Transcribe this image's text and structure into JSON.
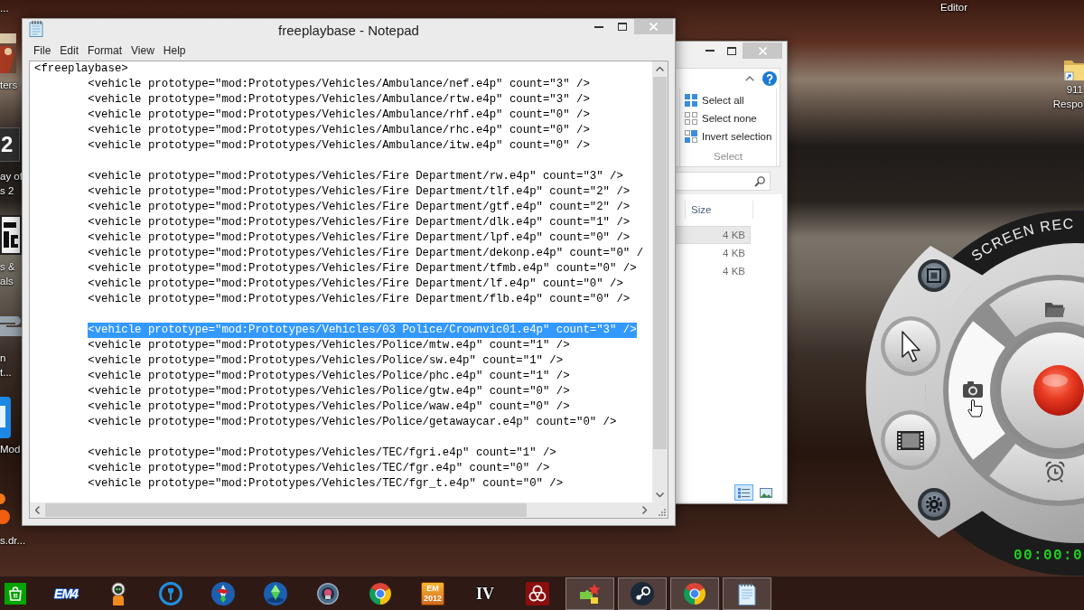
{
  "desktop": {
    "left_icons": [
      {
        "kind": "none",
        "label_lines": [
          "..."
        ]
      },
      {
        "kind": "game-art",
        "label_lines": [
          "ters"
        ]
      },
      {
        "kind": "dark-tile",
        "logo_text": "2",
        "label_lines": [
          "ay of",
          "s 2"
        ]
      },
      {
        "kind": "white-tile",
        "label_lines": [
          "s &",
          "als"
        ]
      },
      {
        "kind": "gray-logo",
        "label_lines": [
          "n",
          "t..."
        ]
      },
      {
        "kind": "blue-tile",
        "label_lines": [
          "Mod"
        ]
      },
      {
        "kind": "orange-dots",
        "label_lines": [
          "s.dr..."
        ]
      }
    ],
    "right_icons": [
      {
        "kind": "none",
        "label_lines": [
          "Editor"
        ]
      },
      {
        "kind": "folder-shortcut",
        "label_lines": [
          "911",
          "Respo"
        ]
      }
    ]
  },
  "notepad": {
    "title": "freeplaybase - Notepad",
    "menu": [
      "File",
      "Edit",
      "Format",
      "View",
      "Help"
    ],
    "root_line": {
      "text": "<freeplaybase>",
      "selected": false
    },
    "groups": [
      {
        "lines": [
          {
            "text": "<vehicle prototype=\"mod:Prototypes/Vehicles/Ambulance/nef.e4p\" count=\"3\" />",
            "selected": false
          },
          {
            "text": "<vehicle prototype=\"mod:Prototypes/Vehicles/Ambulance/rtw.e4p\" count=\"3\" />",
            "selected": false
          },
          {
            "text": "<vehicle prototype=\"mod:Prototypes/Vehicles/Ambulance/rhf.e4p\" count=\"0\" />",
            "selected": false
          },
          {
            "text": "<vehicle prototype=\"mod:Prototypes/Vehicles/Ambulance/rhc.e4p\" count=\"0\" />",
            "selected": false
          },
          {
            "text": "<vehicle prototype=\"mod:Prototypes/Vehicles/Ambulance/itw.e4p\" count=\"0\" />",
            "selected": false
          }
        ]
      },
      {
        "lines": [
          {
            "text": "<vehicle prototype=\"mod:Prototypes/Vehicles/Fire Department/rw.e4p\" count=\"3\" />",
            "selected": false
          },
          {
            "text": "<vehicle prototype=\"mod:Prototypes/Vehicles/Fire Department/tlf.e4p\" count=\"2\" />",
            "selected": false
          },
          {
            "text": "<vehicle prototype=\"mod:Prototypes/Vehicles/Fire Department/gtf.e4p\" count=\"2\" />",
            "selected": false
          },
          {
            "text": "<vehicle prototype=\"mod:Prototypes/Vehicles/Fire Department/dlk.e4p\" count=\"1\" />",
            "selected": false
          },
          {
            "text": "<vehicle prototype=\"mod:Prototypes/Vehicles/Fire Department/lpf.e4p\" count=\"0\" />",
            "selected": false
          },
          {
            "text": "<vehicle prototype=\"mod:Prototypes/Vehicles/Fire Department/dekonp.e4p\" count=\"0\" /",
            "selected": false
          },
          {
            "text": "<vehicle prototype=\"mod:Prototypes/Vehicles/Fire Department/tfmb.e4p\" count=\"0\" />",
            "selected": false
          },
          {
            "text": "<vehicle prototype=\"mod:Prototypes/Vehicles/Fire Department/lf.e4p\" count=\"0\" />",
            "selected": false
          },
          {
            "text": "<vehicle prototype=\"mod:Prototypes/Vehicles/Fire Department/flb.e4p\" count=\"0\" />",
            "selected": false
          }
        ]
      },
      {
        "lines": [
          {
            "text": "<vehicle prototype=\"mod:Prototypes/Vehicles/03 Police/Crownvic01.e4p\" count=\"3\" />",
            "selected": true
          },
          {
            "text": "<vehicle prototype=\"mod:Prototypes/Vehicles/Police/mtw.e4p\" count=\"1\" />",
            "selected": false
          },
          {
            "text": "<vehicle prototype=\"mod:Prototypes/Vehicles/Police/sw.e4p\" count=\"1\" />",
            "selected": false
          },
          {
            "text": "<vehicle prototype=\"mod:Prototypes/Vehicles/Police/phc.e4p\" count=\"1\" />",
            "selected": false
          },
          {
            "text": "<vehicle prototype=\"mod:Prototypes/Vehicles/Police/gtw.e4p\" count=\"0\" />",
            "selected": false
          },
          {
            "text": "<vehicle prototype=\"mod:Prototypes/Vehicles/Police/waw.e4p\" count=\"0\" />",
            "selected": false
          },
          {
            "text": "<vehicle prototype=\"mod:Prototypes/Vehicles/Police/getawaycar.e4p\" count=\"0\" />",
            "selected": false
          }
        ]
      },
      {
        "lines": [
          {
            "text": "<vehicle prototype=\"mod:Prototypes/Vehicles/TEC/fgri.e4p\" count=\"1\" />",
            "selected": false
          },
          {
            "text": "<vehicle prototype=\"mod:Prototypes/Vehicles/TEC/fgr.e4p\" count=\"0\" />",
            "selected": false
          },
          {
            "text": "<vehicle prototype=\"mod:Prototypes/Vehicles/TEC/fgr_t.e4p\" count=\"0\" />",
            "selected": false
          }
        ]
      }
    ]
  },
  "explorer": {
    "commands": [
      {
        "kind": "select-all",
        "label": "Select all"
      },
      {
        "kind": "select-none",
        "label": "Select none"
      },
      {
        "kind": "invert",
        "label": "Invert selection"
      }
    ],
    "group_label": "Select",
    "columns": [
      "Size"
    ],
    "rows": [
      {
        "size": "4 KB",
        "selected": true
      },
      {
        "size": "4 KB",
        "selected": false
      },
      {
        "size": "4 KB",
        "selected": false
      }
    ],
    "views": [
      {
        "kind": "details",
        "selected": true
      },
      {
        "kind": "large-icons",
        "selected": false
      }
    ]
  },
  "recorder": {
    "title": "SCREEN REC",
    "segments": [
      {
        "kind": "folder",
        "hovered": false
      },
      {
        "kind": "camera",
        "hovered": true
      },
      {
        "kind": "alarm",
        "hovered": false
      }
    ],
    "timer": "00:00:0"
  },
  "taskbar": {
    "items": [
      {
        "kind": "store",
        "running": false
      },
      {
        "kind": "logo-text",
        "logo_text": "EM4",
        "running": false
      },
      {
        "kind": "astronaut",
        "running": false
      },
      {
        "kind": "ring-figure",
        "running": false
      },
      {
        "kind": "bird-plumbob",
        "running": false
      },
      {
        "kind": "plumbob",
        "running": false
      },
      {
        "kind": "round-badge",
        "running": false
      },
      {
        "kind": "browser",
        "running": false
      },
      {
        "kind": "logo-tile",
        "logo_text": "EM 2012",
        "running": false
      },
      {
        "kind": "logo-outline",
        "logo_text": "IV",
        "running": false
      },
      {
        "kind": "biohazard",
        "running": false
      },
      {
        "kind": "puzzle",
        "running": true
      },
      {
        "kind": "piston-logo",
        "running": true
      },
      {
        "kind": "browser",
        "running": true
      },
      {
        "kind": "notepad",
        "running": true
      }
    ]
  }
}
